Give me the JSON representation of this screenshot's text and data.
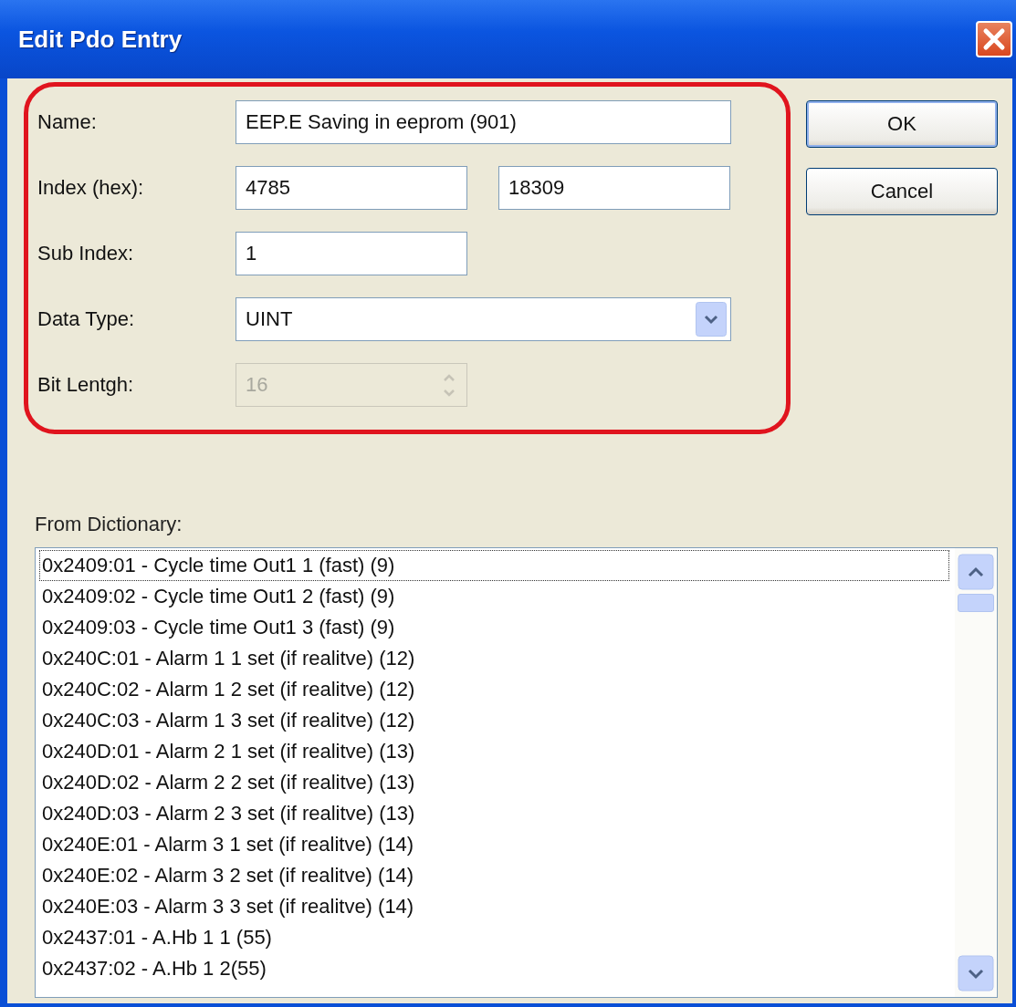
{
  "window": {
    "title": "Edit Pdo Entry"
  },
  "fields": [
    {
      "label": "Name:",
      "kind": "text",
      "values": [
        "EEP.E Saving in eeprom (901)"
      ],
      "disabled": false
    },
    {
      "label": "Index (hex):",
      "kind": "pair",
      "values": [
        "4785",
        "18309"
      ],
      "disabled": false
    },
    {
      "label": "Sub Index:",
      "kind": "short",
      "values": [
        "1"
      ],
      "disabled": false
    },
    {
      "label": "Data Type:",
      "kind": "dropdown",
      "values": [
        "UINT"
      ],
      "disabled": false
    },
    {
      "label": "Bit Lentgh:",
      "kind": "spin",
      "values": [
        "16"
      ],
      "disabled": true
    }
  ],
  "buttons": [
    "OK",
    "Cancel"
  ],
  "dictionary": {
    "label": "From Dictionary:",
    "items": [
      {
        "text": "0x2409:01 - Cycle time Out1 1 (fast) (9)",
        "focused": true
      },
      {
        "text": "0x2409:02 - Cycle time Out1 2 (fast) (9)",
        "focused": false
      },
      {
        "text": "0x2409:03 - Cycle time Out1 3 (fast) (9)",
        "focused": false
      },
      {
        "text": "0x240C:01 - Alarm 1 1 set (if realitve) (12)",
        "focused": false
      },
      {
        "text": "0x240C:02 - Alarm 1 2 set (if realitve) (12)",
        "focused": false
      },
      {
        "text": "0x240C:03 - Alarm 1 3 set (if realitve) (12)",
        "focused": false
      },
      {
        "text": "0x240D:01 - Alarm 2 1 set (if realitve) (13)",
        "focused": false
      },
      {
        "text": "0x240D:02 - Alarm 2 2 set (if realitve) (13)",
        "focused": false
      },
      {
        "text": "0x240D:03 - Alarm 2 3 set (if realitve) (13)",
        "focused": false
      },
      {
        "text": "0x240E:01 - Alarm 3 1 set (if realitve) (14)",
        "focused": false
      },
      {
        "text": "0x240E:02 - Alarm 3 2 set (if realitve) (14)",
        "focused": false
      },
      {
        "text": "0x240E:03 - Alarm 3 3 set (if realitve) (14)",
        "focused": false
      },
      {
        "text": "0x2437:01 - A.Hb 1 1 (55)",
        "focused": false
      },
      {
        "text": "0x2437:02 - A.Hb 1 2(55)",
        "focused": false
      }
    ]
  }
}
